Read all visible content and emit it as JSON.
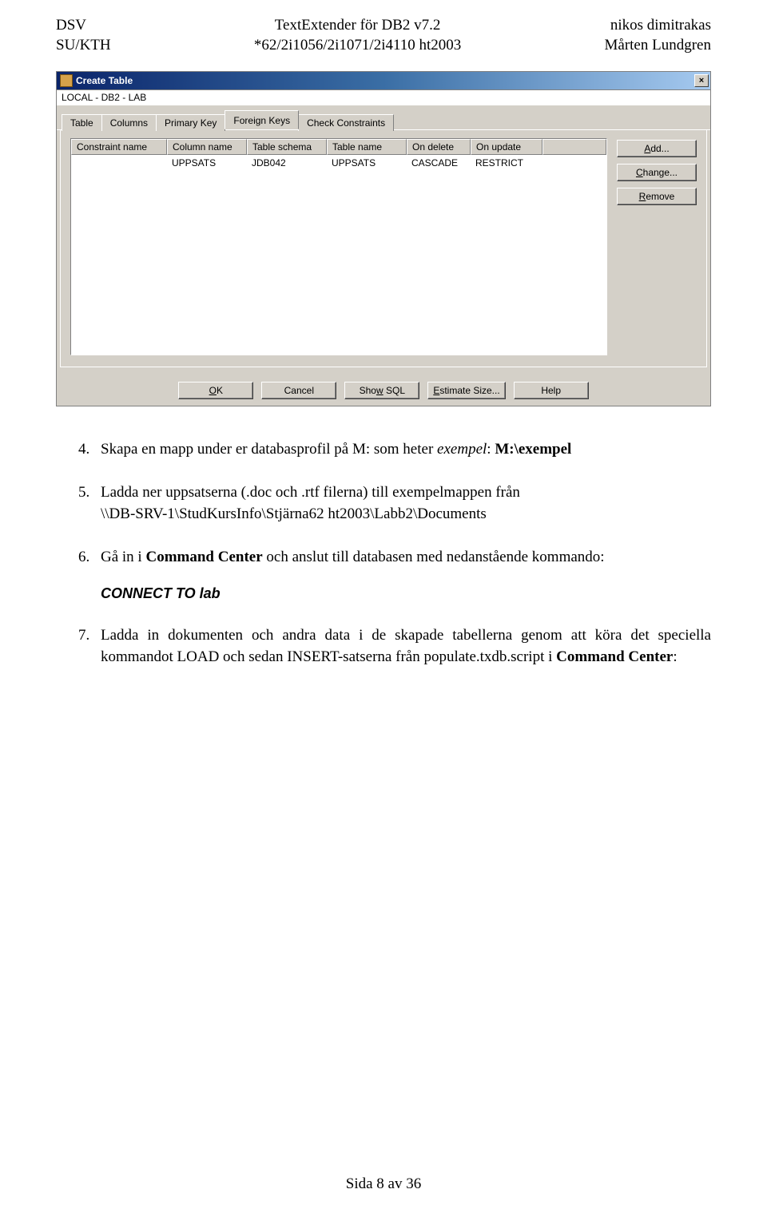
{
  "header": {
    "left_line1": "DSV",
    "left_line2": "SU/KTH",
    "center_line1": "TextExtender för DB2 v7.2",
    "center_line2": "*62/2i1056/2i1071/2i4110 ht2003",
    "right_line1": "nikos dimitrakas",
    "right_line2": "Mårten Lundgren"
  },
  "dialog": {
    "title": "Create Table",
    "path": "LOCAL - DB2 - LAB",
    "tabs": {
      "table": "Table",
      "columns": "Columns",
      "primary_key": "Primary Key",
      "foreign_keys": "Foreign Keys",
      "check_constraints": "Check Constraints"
    },
    "grid": {
      "headers": {
        "constraint_name": "Constraint name",
        "column_name": "Column name",
        "table_schema": "Table schema",
        "table_name": "Table name",
        "on_delete": "On delete",
        "on_update": "On update"
      },
      "rows": [
        {
          "constraint_name": "",
          "column_name": "UPPSATS",
          "table_schema": "JDB042",
          "table_name": "UPPSATS",
          "on_delete": "CASCADE",
          "on_update": "RESTRICT"
        }
      ]
    },
    "side_buttons": {
      "add": "Add...",
      "change": "Change...",
      "remove": "Remove"
    },
    "bottom_buttons": {
      "ok": "OK",
      "cancel": "Cancel",
      "show_sql": "Show SQL",
      "estimate_size": "Estimate Size...",
      "help": "Help"
    }
  },
  "body": {
    "item4_pre": "Skapa en mapp under er databasprofil på M: som heter ",
    "item4_emph": "exempel",
    "item4_mid": ": ",
    "item4_bold": "M:\\exempel",
    "item5_pre": "Ladda ner uppsatserna (.doc och .rtf filerna) till exempelmappen från ",
    "item5_path": "\\\\DB-SRV-1\\StudKursInfo\\Stjärna62 ht2003\\Labb2\\Documents",
    "item6_pre": "Gå in i ",
    "item6_bold": "Command Center",
    "item6_post": " och anslut till databasen med nedanstående kommando:",
    "item6_code": "CONNECT TO lab",
    "item7_pre": "Ladda in dokumenten och andra data i de skapade tabellerna genom att köra det speciella kommandot LOAD och sedan INSERT-satserna från populate.txdb.script i ",
    "item7_bold": "Command Center",
    "item7_post": ":"
  },
  "footer": "Sida 8 av 36"
}
